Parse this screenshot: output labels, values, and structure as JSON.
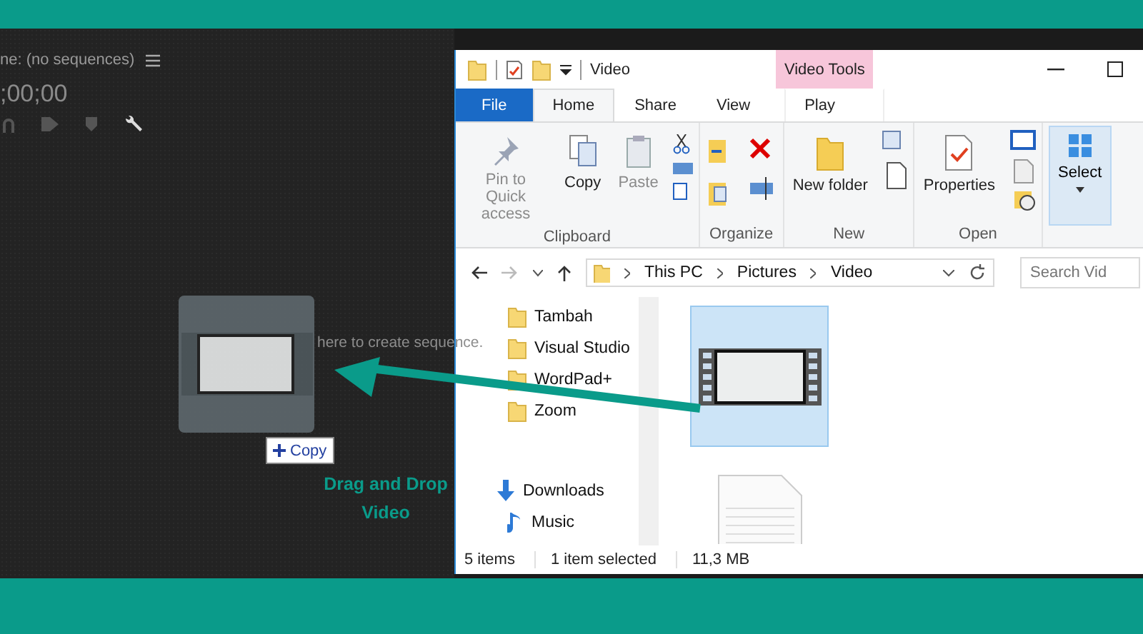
{
  "premiere": {
    "title": "ne: (no sequences)",
    "timecode": ";00;00",
    "drop_hint": "here to create sequence.",
    "drag_badge": {
      "label": "Copy"
    }
  },
  "annotation": {
    "text": "Drag and Drop Video"
  },
  "explorer": {
    "title": "Video",
    "contextual_tab": "Video Tools",
    "tabs": [
      {
        "label": "File",
        "kind": "file",
        "selected": false
      },
      {
        "label": "Home",
        "kind": "tab",
        "selected": true
      },
      {
        "label": "Share",
        "kind": "tab",
        "selected": false
      },
      {
        "label": "View",
        "kind": "tab",
        "selected": false
      },
      {
        "label": "Play",
        "kind": "contextual",
        "selected": false
      }
    ],
    "groups": [
      {
        "label": "Clipboard",
        "buttons": [
          {
            "label": "Pin to Quick access",
            "kind": "pin",
            "disabled": true
          },
          {
            "label": "Copy",
            "kind": "copy",
            "disabled": false
          },
          {
            "label": "Paste",
            "kind": "paste",
            "disabled": true
          }
        ]
      },
      {
        "label": "Organize"
      },
      {
        "label": "New",
        "buttons": [
          {
            "label": "New folder",
            "kind": "folder",
            "disabled": false
          }
        ]
      },
      {
        "label": "Open",
        "buttons": [
          {
            "label": "Properties",
            "kind": "properties",
            "disabled": false
          }
        ]
      }
    ],
    "select_button": {
      "label": "Select",
      "pressed": true
    },
    "breadcrumb": [
      "This PC",
      "Pictures",
      "Video"
    ],
    "search": {
      "placeholder": "Search Vid"
    },
    "nav": [
      {
        "label": "Tambah",
        "kind": "folder"
      },
      {
        "label": "Visual Studio",
        "kind": "folder"
      },
      {
        "label": "WordPad+",
        "kind": "folder"
      },
      {
        "label": "Zoom",
        "kind": "folder"
      },
      {
        "label": "Downloads",
        "kind": "downloads"
      },
      {
        "label": "Music",
        "kind": "music"
      }
    ],
    "files": [
      {
        "kind": "video",
        "selected": true
      },
      {
        "kind": "document",
        "selected": false
      }
    ],
    "status": [
      "5 items",
      "1 item selected",
      "11,3 MB"
    ]
  }
}
